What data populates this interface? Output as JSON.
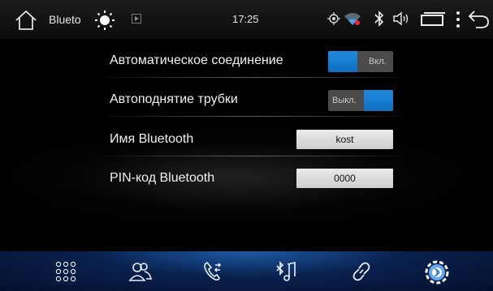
{
  "statusbar": {
    "title": "Blueto",
    "time": "17:25",
    "icons": [
      "home-icon",
      "brightness-icon",
      "media-play-icon",
      "gps-icon",
      "wifi-icon",
      "bluetooth-icon",
      "volume-icon",
      "recent-apps-icon",
      "more-menu-icon",
      "back-icon"
    ]
  },
  "settings": {
    "auto_connect": {
      "label": "Автоматическое соединение",
      "state_text": "Вкл.",
      "enabled": true
    },
    "auto_answer": {
      "label": "Автоподнятие трубки",
      "state_text": "Выкл.",
      "enabled": false
    },
    "bt_name": {
      "label": "Имя Bluetooth",
      "value": "kost"
    },
    "bt_pin": {
      "label": "PIN-код Bluetooth",
      "value": "0000"
    }
  },
  "dock": {
    "items": [
      "keypad-icon",
      "contacts-icon",
      "call-log-icon",
      "bt-music-icon",
      "link-icon",
      "settings-gear-icon"
    ],
    "active": "settings-gear-icon"
  },
  "colors": {
    "accent": "#1e8be0",
    "toggle_off": "#4b4b4b",
    "field_bg": "#dcdcdc"
  }
}
